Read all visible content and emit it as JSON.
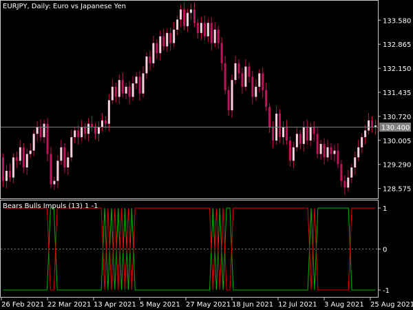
{
  "header": {
    "symbol_title": "EURJPY, Daily:  Euro vs Japanese Yen"
  },
  "indicator": {
    "title": "Bears Bulls Impuls (13) 1 -1"
  },
  "colors": {
    "background": "#000000",
    "frame": "#c8c8c8",
    "bull_body": "#ffd1dc",
    "bear_body": "#c0145a",
    "wick": "#c0145a",
    "current_price_line": "#808080",
    "price_tag_bg": "#808080",
    "bull_line": "#00b400",
    "bear_line": "#e00000",
    "zero_line": "#808080",
    "text": "#ffffff"
  },
  "chart_data": [
    {
      "type": "candlestick",
      "title": "EURJPY, Daily:  Euro vs Japanese Yen",
      "ylim": [
        128.3,
        134.14
      ],
      "y_ticks": [
        "133.580",
        "132.865",
        "132.150",
        "131.435",
        "130.720",
        "130.005",
        "129.290",
        "128.575"
      ],
      "current_price": "130.400",
      "x_ticks": [
        "26 Feb 2021",
        "22 Mar 2021",
        "13 Apr 2021",
        "5 May 2021",
        "27 May 2021",
        "18 Jun 2021",
        "12 Jul 2021",
        "3 Aug 2021",
        "25 Aug 2021"
      ],
      "candles": [
        [
          129.5,
          128.8
        ],
        [
          128.8,
          129.1
        ],
        [
          129.1,
          128.9
        ],
        [
          128.9,
          129.5
        ],
        [
          129.5,
          129.4
        ],
        [
          129.4,
          129.8
        ],
        [
          129.8,
          129.2
        ],
        [
          129.2,
          129.6
        ],
        [
          129.6,
          129.7
        ],
        [
          129.7,
          130.2
        ],
        [
          130.2,
          130.4
        ],
        [
          130.4,
          130.1
        ],
        [
          130.1,
          130.5
        ],
        [
          130.5,
          129.6
        ],
        [
          129.6,
          128.7
        ],
        [
          128.7,
          128.8
        ],
        [
          128.8,
          129.4
        ],
        [
          129.4,
          129.8
        ],
        [
          129.8,
          129.2
        ],
        [
          129.2,
          129.5
        ],
        [
          129.5,
          130.1
        ],
        [
          130.1,
          130.3
        ],
        [
          130.3,
          130.1
        ],
        [
          130.1,
          130.4
        ],
        [
          130.4,
          130.2
        ],
        [
          130.2,
          130.5
        ],
        [
          130.5,
          130.4
        ],
        [
          130.4,
          130.2
        ],
        [
          130.2,
          130.4
        ],
        [
          130.4,
          130.6
        ],
        [
          130.6,
          130.5
        ],
        [
          130.5,
          131.2
        ],
        [
          131.2,
          131.6
        ],
        [
          131.6,
          131.3
        ],
        [
          131.3,
          131.8
        ],
        [
          131.8,
          131.4
        ],
        [
          131.4,
          131.6
        ],
        [
          131.6,
          131.3
        ],
        [
          131.3,
          131.7
        ],
        [
          131.7,
          131.9
        ],
        [
          131.9,
          131.4
        ],
        [
          131.4,
          132.0
        ],
        [
          132.0,
          132.5
        ],
        [
          132.5,
          132.3
        ],
        [
          132.3,
          132.9
        ],
        [
          132.9,
          132.6
        ],
        [
          132.6,
          133.1
        ],
        [
          133.1,
          132.8
        ],
        [
          132.8,
          133.2
        ],
        [
          133.2,
          132.9
        ],
        [
          132.9,
          133.3
        ],
        [
          133.3,
          133.6
        ],
        [
          133.6,
          133.9
        ],
        [
          133.9,
          133.4
        ],
        [
          133.4,
          133.8
        ],
        [
          133.8,
          133.9
        ],
        [
          133.9,
          133.5
        ],
        [
          133.5,
          133.2
        ],
        [
          133.2,
          133.5
        ],
        [
          133.5,
          133.1
        ],
        [
          133.1,
          133.5
        ],
        [
          133.5,
          132.9
        ],
        [
          132.9,
          133.3
        ],
        [
          133.3,
          132.9
        ],
        [
          132.9,
          132.3
        ],
        [
          132.3,
          131.5
        ],
        [
          131.5,
          130.9
        ],
        [
          130.9,
          131.8
        ],
        [
          131.8,
          132.3
        ],
        [
          132.3,
          132.0
        ],
        [
          132.0,
          131.6
        ],
        [
          131.6,
          132.2
        ],
        [
          132.2,
          131.9
        ],
        [
          131.9,
          131.3
        ],
        [
          131.3,
          131.6
        ],
        [
          131.6,
          132.0
        ],
        [
          132.0,
          131.5
        ],
        [
          131.5,
          131.0
        ],
        [
          131.0,
          130.4
        ],
        [
          130.4,
          130.0
        ],
        [
          130.0,
          130.8
        ],
        [
          130.8,
          130.1
        ],
        [
          130.1,
          130.4
        ],
        [
          130.4,
          130.0
        ],
        [
          130.0,
          129.4
        ],
        [
          129.4,
          129.8
        ],
        [
          129.8,
          130.2
        ],
        [
          130.2,
          129.9
        ],
        [
          129.9,
          130.4
        ],
        [
          130.4,
          130.0
        ],
        [
          130.0,
          130.4
        ],
        [
          130.4,
          130.2
        ],
        [
          130.2,
          129.6
        ],
        [
          129.6,
          129.9
        ],
        [
          129.9,
          129.5
        ],
        [
          129.5,
          129.8
        ],
        [
          129.8,
          129.6
        ],
        [
          129.6,
          129.7
        ],
        [
          129.7,
          129.3
        ],
        [
          129.3,
          128.8
        ],
        [
          128.8,
          128.6
        ],
        [
          128.6,
          128.9
        ],
        [
          128.9,
          129.2
        ],
        [
          129.2,
          129.5
        ],
        [
          129.5,
          129.8
        ],
        [
          129.8,
          130.1
        ],
        [
          130.1,
          130.3
        ],
        [
          130.3,
          130.6
        ],
        [
          130.6,
          130.4
        ],
        [
          130.4,
          130.45
        ]
      ]
    },
    {
      "type": "line",
      "title": "Bears Bulls Impuls (13) 1 -1",
      "ylim": [
        -1,
        1
      ],
      "y_ticks": [
        "1",
        "0",
        "-1"
      ],
      "series": [
        {
          "values": [
            -1,
            -1,
            -1,
            -1,
            -1,
            -1,
            -1,
            -1,
            -1,
            -1,
            -1,
            -1,
            -1,
            -1,
            1,
            1,
            -1,
            -1,
            -1,
            -1,
            -1,
            -1,
            -1,
            -1,
            -1,
            -1,
            -1,
            -1,
            -1,
            -1,
            1,
            -1,
            1,
            -1,
            1,
            -1,
            1,
            -1,
            1,
            -1,
            -1,
            -1,
            -1,
            -1,
            -1,
            -1,
            -1,
            -1,
            -1,
            -1,
            -1,
            -1,
            -1,
            -1,
            -1,
            -1,
            -1,
            -1,
            -1,
            -1,
            -1,
            -1,
            1,
            -1,
            1,
            -1,
            1,
            1,
            -1,
            -1,
            -1,
            -1,
            -1,
            -1,
            -1,
            -1,
            -1,
            -1,
            -1,
            -1,
            -1,
            -1,
            -1,
            -1,
            -1,
            -1,
            -1,
            -1,
            -1,
            -1,
            -1,
            1,
            -1,
            1,
            1,
            1,
            1,
            1,
            1,
            1,
            1,
            1,
            1,
            -1,
            -1,
            -1,
            -1,
            -1,
            -1,
            -1,
            -1
          ]
        },
        {
          "values": [
            1,
            1,
            1,
            1,
            1,
            1,
            1,
            1,
            1,
            1,
            1,
            1,
            1,
            1,
            -1,
            -1,
            1,
            1,
            1,
            1,
            1,
            1,
            1,
            1,
            1,
            1,
            1,
            1,
            1,
            1,
            -1,
            1,
            -1,
            1,
            -1,
            1,
            -1,
            1,
            -1,
            1,
            1,
            1,
            1,
            1,
            1,
            1,
            1,
            1,
            1,
            1,
            1,
            1,
            1,
            1,
            1,
            1,
            1,
            1,
            1,
            1,
            1,
            1,
            -1,
            1,
            -1,
            1,
            -1,
            -1,
            1,
            1,
            1,
            1,
            1,
            1,
            1,
            1,
            1,
            1,
            1,
            1,
            1,
            1,
            1,
            1,
            1,
            1,
            1,
            1,
            1,
            1,
            1,
            -1,
            1,
            -1,
            -1,
            -1,
            -1,
            -1,
            -1,
            -1,
            -1,
            -1,
            -1,
            1,
            1,
            1,
            1,
            1,
            1,
            1,
            1
          ]
        }
      ]
    }
  ]
}
